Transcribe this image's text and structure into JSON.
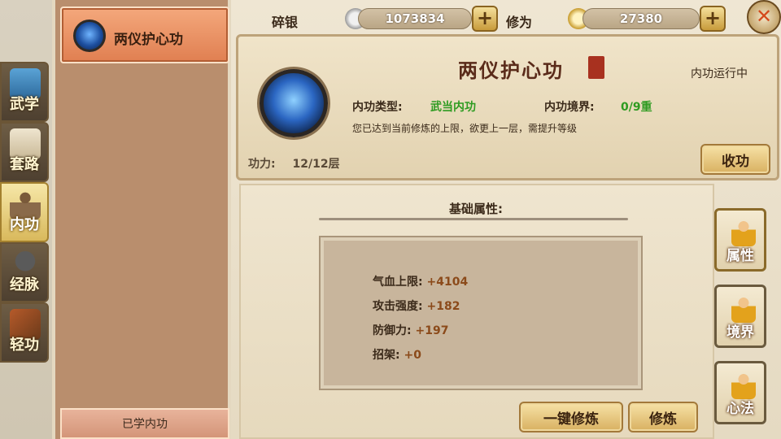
{
  "resources": {
    "silver_label": "碎银",
    "silver_value": "1073834",
    "cultivation_label": "修为",
    "cultivation_value": "27380"
  },
  "category_tabs": [
    {
      "label": "武学",
      "active": false
    },
    {
      "label": "套路",
      "active": false
    },
    {
      "label": "内功",
      "active": true
    },
    {
      "label": "经脉",
      "active": false
    },
    {
      "label": "轻功",
      "active": false
    }
  ],
  "skill_list": {
    "items": [
      {
        "name": "两仪护心功"
      }
    ],
    "learned_tab": "已学内功"
  },
  "detail": {
    "title": "两仪护心功",
    "status": "内功运行中",
    "type_label": "内功类型:",
    "type_value": "武当内功",
    "realm_label": "内功境界:",
    "realm_value": "0/9重",
    "limit_message": "您已达到当前修炼的上限，欲更上一层，需提升等级",
    "power_label": "功力:",
    "power_value": "12/12层",
    "retract_button": "收功"
  },
  "attributes": {
    "heading": "基础属性:",
    "stats": [
      {
        "key": "气血上限:",
        "value": "+4104"
      },
      {
        "key": "攻击强度:",
        "value": "+182"
      },
      {
        "key": "防御力:",
        "value": "+197"
      },
      {
        "key": "招架:",
        "value": "+0"
      }
    ]
  },
  "actions": {
    "one_click_train": "一键修炼",
    "train": "修炼"
  },
  "side_tabs": [
    {
      "label": "属性",
      "active": true
    },
    {
      "label": "境界",
      "active": false
    },
    {
      "label": "心法",
      "active": false
    }
  ],
  "plus_symbol": "+",
  "close_symbol": "✕"
}
